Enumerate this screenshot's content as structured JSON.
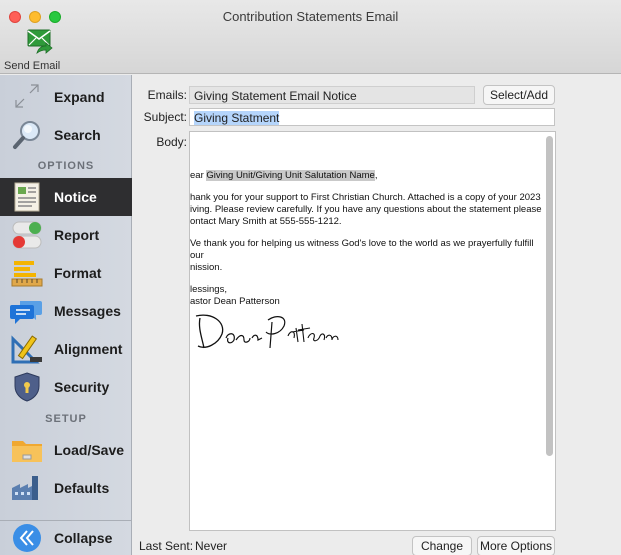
{
  "window": {
    "title": "Contribution Statements Email"
  },
  "toolbar": {
    "send_email_label": "Send Email"
  },
  "sidebar": {
    "expand": "Expand",
    "search": "Search",
    "section_options": "OPTIONS",
    "notice": "Notice",
    "report": "Report",
    "format": "Format",
    "messages": "Messages",
    "alignment": "Alignment",
    "security": "Security",
    "section_setup": "SETUP",
    "load_save": "Load/Save",
    "defaults": "Defaults",
    "collapse": "Collapse",
    "active_item": "Notice"
  },
  "form": {
    "emails_label": "Emails:",
    "emails_value": "Giving Statement Email Notice",
    "select_add_button": "Select/Add",
    "subject_label": "Subject:",
    "subject_value": "Giving Statment",
    "body_label": "Body:",
    "body": {
      "greeting_prefix": "ear ",
      "merge_field": "Giving Unit/Giving Unit Salutation Name",
      "greeting_suffix": ",",
      "paragraph1": "hank you for your support to First Christian Church. Attached is a copy of your 2023\niving. Please review carefully. If you have any questions about the statement please\nontact Mary Smith at 555-555-1212.",
      "paragraph2": "Ve thank you for helping us witness God's love to the world as we prayerfully fulfill our\nnission.",
      "closing": "lessings,\nastor Dean Patterson"
    },
    "last_sent_label": "Last Sent:",
    "last_sent_value": "Never",
    "change_button": "Change",
    "more_options_button": "More Options"
  },
  "colors": {
    "sidebar_active_bg": "#2e2e30",
    "selection_highlight": "#b5d5fb",
    "send_icon_green": "#2f9a3a"
  },
  "icons": {
    "send_email": "envelope-arrow-icon",
    "expand": "expand-arrows-icon",
    "search": "magnifier-icon",
    "notice": "document-icon",
    "report": "toggle-switches-icon",
    "format": "pencil-ruler-icon",
    "messages": "chat-bubbles-icon",
    "alignment": "drafting-tools-icon",
    "security": "shield-lock-icon",
    "load_save": "folder-icon",
    "defaults": "factory-icon",
    "collapse": "double-chevron-left-icon"
  }
}
